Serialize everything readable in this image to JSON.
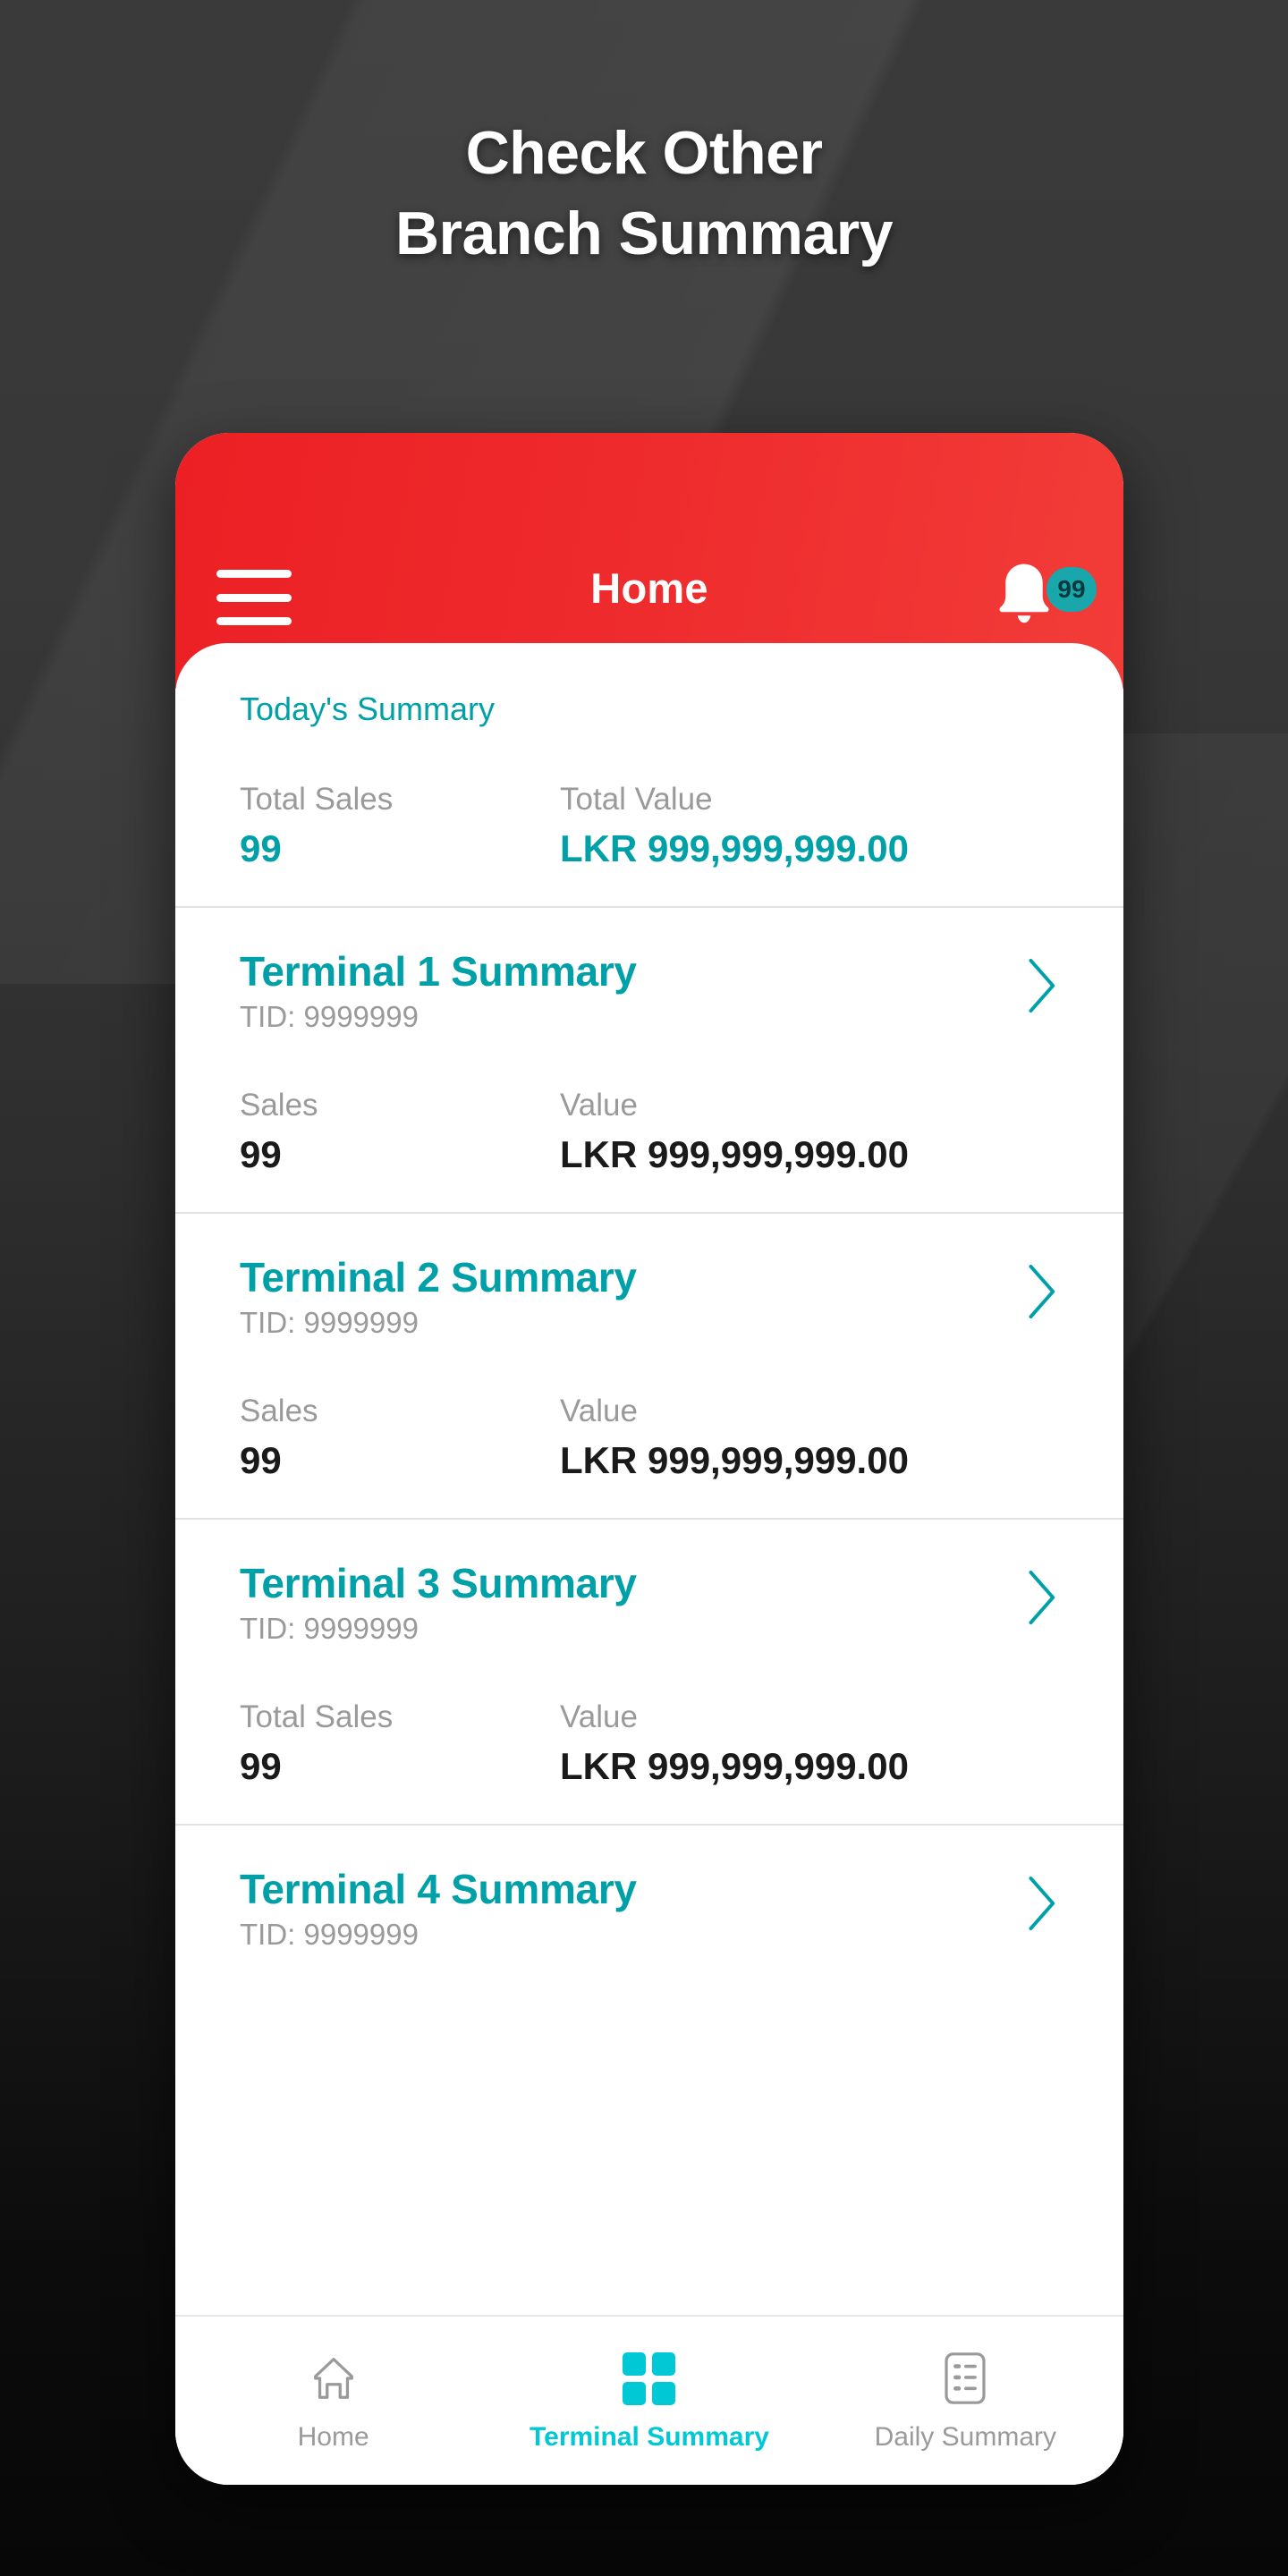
{
  "promo": {
    "headline_line1": "Check Other",
    "headline_line2": "Branch Summary"
  },
  "colors": {
    "brand_red": "#ee2a2c",
    "teal": "#00a0a8",
    "cyan_active": "#00c8d4",
    "muted_gray": "#9a9a9a",
    "dark_text": "#1a1a1a",
    "badge_teal": "#1aa7ac"
  },
  "appbar": {
    "menu_icon": "hamburger-icon",
    "title": "Home",
    "bell_icon": "notification-bell-icon",
    "badge_count": "99"
  },
  "today_summary": {
    "title": "Today's Summary",
    "metrics": [
      {
        "label": "Total Sales",
        "value": "99"
      },
      {
        "label": "Total Value",
        "value": "LKR 999,999,999.00"
      }
    ]
  },
  "terminals": [
    {
      "name": "Terminal 1 Summary",
      "tid": "TID: 9999999",
      "chevron_icon": "chevron-right-icon",
      "metrics": [
        {
          "label": "Sales",
          "value": "99"
        },
        {
          "label": "Value",
          "value": "LKR 999,999,999.00"
        }
      ]
    },
    {
      "name": "Terminal 2 Summary",
      "tid": "TID: 9999999",
      "chevron_icon": "chevron-right-icon",
      "metrics": [
        {
          "label": "Sales",
          "value": "99"
        },
        {
          "label": "Value",
          "value": "LKR 999,999,999.00"
        }
      ]
    },
    {
      "name": "Terminal 3 Summary",
      "tid": "TID: 9999999",
      "chevron_icon": "chevron-right-icon",
      "metrics": [
        {
          "label": "Total Sales",
          "value": "99"
        },
        {
          "label": "Value",
          "value": "LKR 999,999,999.00"
        }
      ]
    },
    {
      "name": "Terminal 4 Summary",
      "tid": "TID: 9999999",
      "chevron_icon": "chevron-right-icon",
      "metrics": []
    }
  ],
  "bottom_nav": [
    {
      "label": "Home",
      "icon": "home-icon",
      "active": false
    },
    {
      "label": "Terminal Summary",
      "icon": "grid-squares-icon",
      "active": true
    },
    {
      "label": "Daily Summary",
      "icon": "list-document-icon",
      "active": false
    }
  ]
}
